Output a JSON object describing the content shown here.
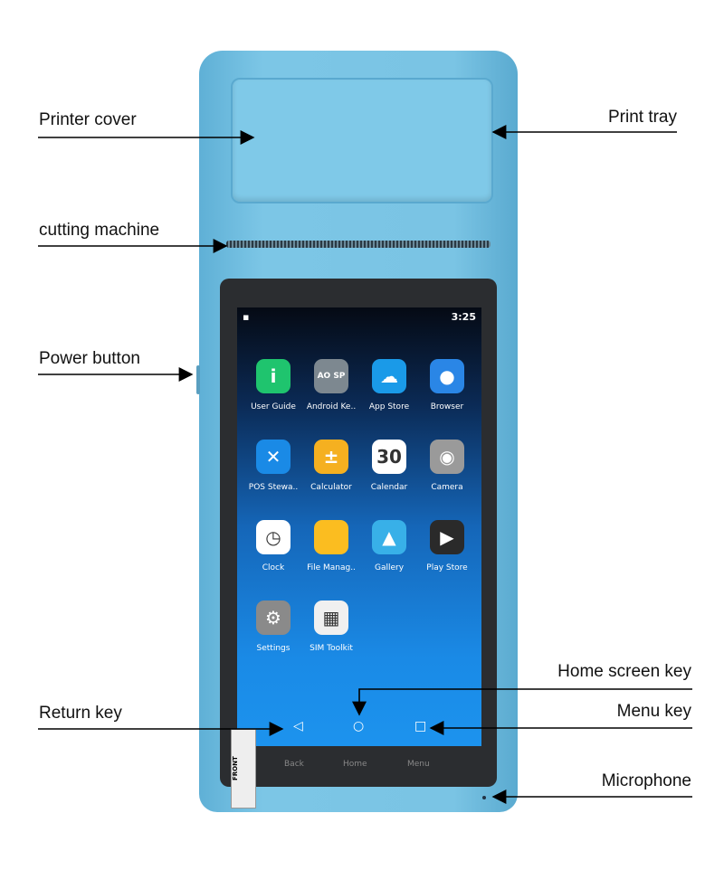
{
  "labels": {
    "printer_cover": "Printer cover",
    "print_tray": "Print tray",
    "cutting_machine": "cutting machine",
    "power_button": "Power button",
    "home_screen_key": "Home screen key",
    "return_key": "Return key",
    "menu_key": "Menu key",
    "microphone": "Microphone"
  },
  "device_color": "#7ac4e4",
  "screen": {
    "time": "3:25",
    "apps": [
      {
        "label": "User Guide",
        "icon": "info-icon",
        "color": "#1fc46e",
        "glyph": "i"
      },
      {
        "label": "Android Ke..",
        "icon": "keyboard-icon",
        "color": "#7d8890",
        "glyph": "AO SP"
      },
      {
        "label": "App Store",
        "icon": "cloud-icon",
        "color": "#1a9ae8",
        "glyph": "☁"
      },
      {
        "label": "Browser",
        "icon": "planet-icon",
        "color": "#2a86e6",
        "glyph": "●"
      },
      {
        "label": "POS Stewa..",
        "icon": "tools-icon",
        "color": "#1a8ae6",
        "glyph": "✕"
      },
      {
        "label": "Calculator",
        "icon": "calculator-icon",
        "color": "#f5b020",
        "glyph": "±"
      },
      {
        "label": "Calendar",
        "icon": "calendar-icon",
        "color": "#ffffff",
        "glyph": "30"
      },
      {
        "label": "Camera",
        "icon": "camera-icon",
        "color": "#9a9a9a",
        "glyph": "◉"
      },
      {
        "label": "Clock",
        "icon": "clock-icon",
        "color": "#ffffff",
        "glyph": "◷"
      },
      {
        "label": "File Manag..",
        "icon": "folder-icon",
        "color": "#fbbd20",
        "glyph": ""
      },
      {
        "label": "Gallery",
        "icon": "gallery-icon",
        "color": "#38b0e8",
        "glyph": "▲"
      },
      {
        "label": "Play Store",
        "icon": "play-store-icon",
        "color": "#2a2a2a",
        "glyph": "▶"
      },
      {
        "label": "Settings",
        "icon": "settings-icon",
        "color": "#8a8a8a",
        "glyph": "⚙"
      },
      {
        "label": "SIM Toolkit",
        "icon": "sim-icon",
        "color": "#f0f0f0",
        "glyph": "▦"
      }
    ],
    "nav": {
      "back": "◁",
      "home": "○",
      "menu": "□"
    }
  },
  "hardware_keys": {
    "back": "Back",
    "home": "Home",
    "menu": "Menu"
  },
  "sticker": "FRONT"
}
